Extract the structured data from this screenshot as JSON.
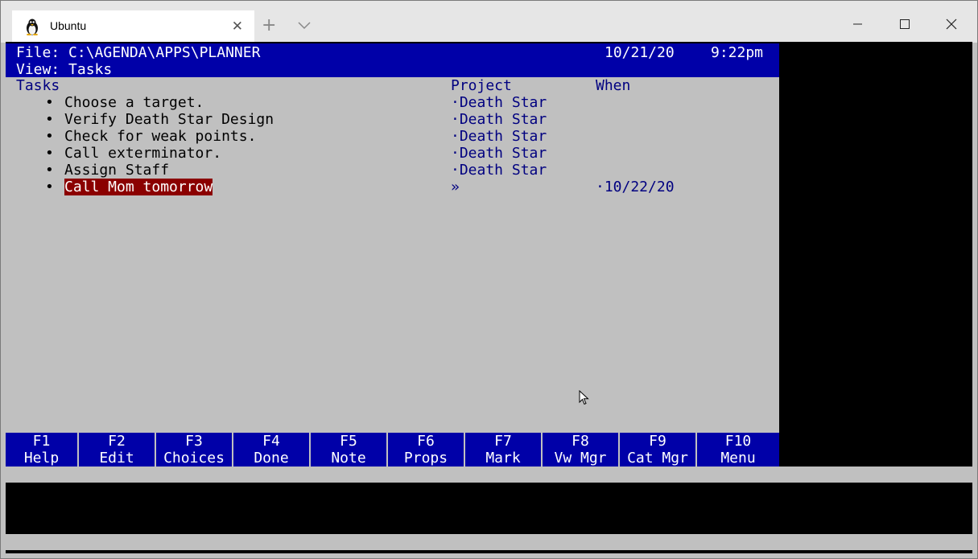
{
  "window": {
    "tab_title": "Ubuntu",
    "tab_icon": "linux-penguin-icon",
    "controls": [
      "minimize-icon",
      "maximize-icon",
      "close-icon"
    ]
  },
  "header": {
    "file_label": "File: C:\\AGENDA\\APPS\\PLANNER",
    "view_label": "View: Tasks",
    "date": "10/21/20",
    "time": "9:22pm"
  },
  "columns": {
    "tasks": "Tasks",
    "project": "Project",
    "when": "When"
  },
  "tasks": [
    {
      "bullet": "•",
      "text": "Choose a target.",
      "project": "·Death Star",
      "when": ""
    },
    {
      "bullet": "•",
      "text": "Verify Death Star Design",
      "project": "·Death Star",
      "when": ""
    },
    {
      "bullet": "•",
      "text": "Check for weak points.",
      "project": "·Death Star",
      "when": ""
    },
    {
      "bullet": "•",
      "text": "Call exterminator.",
      "project": "·Death Star",
      "when": ""
    },
    {
      "bullet": "•",
      "text": "Assign Staff",
      "project": "·Death Star",
      "when": ""
    },
    {
      "bullet": "•",
      "text": "Call Mom tomorrow",
      "project": "»",
      "when": "·10/22/20"
    }
  ],
  "function_keys": [
    {
      "key": "F1",
      "label": "Help"
    },
    {
      "key": "F2",
      "label": "Edit"
    },
    {
      "key": "F3",
      "label": "Choices"
    },
    {
      "key": "F4",
      "label": "Done"
    },
    {
      "key": "F5",
      "label": "Note"
    },
    {
      "key": "F6",
      "label": "Props"
    },
    {
      "key": "F7",
      "label": "Mark"
    },
    {
      "key": "F8",
      "label": "Vw Mgr"
    },
    {
      "key": "F9",
      "label": "Cat Mgr"
    },
    {
      "key": "F10",
      "label": "Menu"
    }
  ],
  "colors": {
    "header_bg": "#0000a8",
    "screen_bg": "#c0c0c0",
    "highlight": "#8b0000"
  }
}
